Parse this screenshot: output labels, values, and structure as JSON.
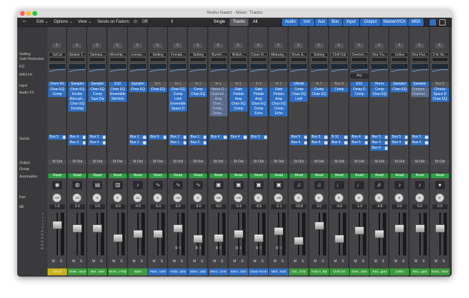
{
  "window": {
    "title": "Yeshu Naam - Mixer: Tracks"
  },
  "toolbar": {
    "edit_label": "Edit",
    "options_label": "Options",
    "view_label": "View",
    "sends_label": "Sends on Faders:",
    "sends_value": "Off",
    "view_tabs": [
      "Single",
      "Tracks",
      "All"
    ],
    "active_view_tab": "Tracks",
    "filter_tabs": [
      "Audio",
      "Inst",
      "Aux",
      "Bus",
      "Input",
      "Output",
      "Master/VCA",
      "MIDI"
    ]
  },
  "row_labels": {
    "setting": "Setting",
    "gain_reduction": "Gain Reduction",
    "eq": "EQ",
    "midi_fx": "MIDI FX",
    "input": "Input",
    "audio_fx": "Audio FX",
    "sends": "Sends",
    "output": "Output",
    "group": "Group",
    "automation": "Automation",
    "pan": "Pan",
    "db": "dB"
  },
  "strips": [
    {
      "setting": "SoCal",
      "input": "Drum Kit",
      "fx": [
        "Chan EQ",
        "Comp"
      ],
      "sends": [
        {
          "bus": "Bus 5"
        }
      ],
      "output": "St Out",
      "automation": "Read",
      "icon": "◉",
      "pan": "+27",
      "db": "1.0",
      "name": "SoCal",
      "name_color": "#c9b21a",
      "fader": 0.78,
      "solo": false,
      "ri": false
    },
    {
      "setting": "Shaker 1...",
      "input": "Sampler",
      "fx": [
        "Chan EQ",
        "Exciter",
        "Bitcrush...",
        "Chan EQ",
        "Envelop"
      ],
      "sends": [
        {
          "bus": "Bus 4"
        },
        {
          "bus": "Bus 3"
        }
      ],
      "output": "St Out",
      "automation": "Read",
      "icon": "◍",
      "pan": "-14",
      "db": "0.0",
      "name": "Shak...ance",
      "name_color": "#3d9b3d",
      "fader": 0.7,
      "solo": false,
      "ri": false
    },
    {
      "setting": "Steinwa...",
      "input": "Sampler",
      "fx": [
        "Chan EQ",
        "Comp",
        "Tape Dly"
      ],
      "sends": [
        {
          "bus": "Bus 3"
        },
        {
          "bus": "Bus 4"
        }
      ],
      "output": "St Out",
      "automation": "Read",
      "icon": "▤",
      "pan": "0",
      "db": "0.0",
      "name": "Stei...iano",
      "name_color": "#3d9b3d",
      "fader": 0.7,
      "solo": false,
      "ri": false
    },
    {
      "setting": "Worship...",
      "input": "ES2",
      "fx": [
        "Chan EQ",
        "Ensemble",
        "SilvVerb"
      ],
      "sends": [],
      "output": "St Out",
      "automation": "Read",
      "icon": "▥",
      "pan": "0",
      "db": "-8.0",
      "name": "Wors...t Pad",
      "name_color": "#3d9b3d",
      "fader": 0.45,
      "solo": false,
      "ri": false
    },
    {
      "setting": "Liverpo...",
      "input": "Sampler",
      "fx": [
        "Chan EQ"
      ],
      "sends": [
        {
          "bus": "Bus 2"
        },
        {
          "bus": "Bus 1"
        }
      ],
      "output": "St Out",
      "automation": "Read",
      "icon": "♪",
      "pan": "-14",
      "db": "-4.5",
      "name": "Bass",
      "name_color": "#3d9b3d",
      "fader": 0.56,
      "solo": false,
      "ri": false
    },
    {
      "setting": "Setting",
      "input": "In 1",
      "fx": [
        "Chan EQ"
      ],
      "sends": [
        {
          "bus": "Bus 6"
        }
      ],
      "output": "St Out",
      "automation": "Read",
      "icon": "∿",
      "pan": "0",
      "db": "-5.0",
      "name": "Parti...Verb",
      "name_color": "#2f6fc4",
      "fader": 0.55,
      "solo": false,
      "ri": false
    },
    {
      "setting": "Female...",
      "input": "In 1",
      "fx": [
        "Chan EQ",
        "Comp",
        "Limit",
        "Ensemble",
        "Space D"
      ],
      "sends": [
        {
          "bus": "Bus 2"
        },
        {
          "bus": "Bus 1"
        }
      ],
      "output": "St Out",
      "automation": "Read",
      "icon": "∿",
      "pan": "+24",
      "db": "0.0",
      "name": "Ambi...uitar",
      "name_color": "#2f6fc4",
      "fader": 0.7,
      "solo": false,
      "ri": true
    },
    {
      "setting": "Setting",
      "input": "In 1",
      "fx": [
        "Comp",
        "Chan EQ"
      ],
      "sends": [
        {
          "bus": "Bus 1"
        },
        {
          "bus": "Bus 2"
        }
      ],
      "output": "St Out",
      "automation": "Read",
      "icon": "∿",
      "pan": "0",
      "db": "-9.0",
      "name": "Elect...uitar",
      "name_color": "#2f6fc4",
      "fader": 0.42,
      "solo": false,
      "ri": true
    },
    {
      "setting": "Burnin'...",
      "input": "In 1",
      "fx": [
        "Noise G.",
        "Channel...",
        "Amp",
        "Chan...",
        "Comp...",
        "Delay..."
      ],
      "fx_dim": true,
      "sends": [
        {
          "bus": "Bus 4"
        }
      ],
      "output": "St Out",
      "automation": "Read",
      "icon": "▣",
      "pan": "+25",
      "db": "-8.0",
      "name": "Elect...Solo",
      "name_color": "#2f6fc4",
      "fader": 0.45,
      "solo": false,
      "ri": true
    },
    {
      "setting": "British...",
      "input": "In 1",
      "fx": [
        "Gate",
        "Pedals",
        "Amp",
        "Chan EQ",
        "Comp"
      ],
      "sends": [
        {
          "bus": "Bus 4"
        }
      ],
      "output": "St Out",
      "automation": "Read",
      "icon": "▣",
      "pan": "+25",
      "db": "-5.6",
      "name": "Elect...Dist",
      "name_color": "#2f6fc4",
      "fader": 0.55,
      "solo": false,
      "ri": true
    },
    {
      "setting": "Clean R...",
      "input": "In 1",
      "fx": [
        "Gate",
        "Pedals",
        "Amp",
        "Chan EQ",
        "Comp",
        "Echo"
      ],
      "sends": [
        {
          "bus": "Bus 5"
        }
      ],
      "output": "St Out",
      "automation": "Read",
      "icon": "▣",
      "pan": "0",
      "db": "-8.5",
      "name": "Clean Room",
      "name_color": "#2f6fc4",
      "fader": 0.44,
      "solo": false,
      "ri": true
    },
    {
      "setting": "Midrang...",
      "input": "In 1",
      "fx": [
        "Gate",
        "Pedals",
        "Amp",
        "Chan EQ",
        "Comp",
        "Echo"
      ],
      "sends": [],
      "output": "St Out",
      "automation": "Read",
      "icon": "▣",
      "pan": "+25",
      "db": "-2.1",
      "name": "Midr...Solo",
      "name_color": "#2f6fc4",
      "fader": 0.62,
      "solo": false,
      "ri": true
    },
    {
      "setting": "Drum &...",
      "input": "Ultrabt",
      "fx": [
        "Comp",
        "Chan EQ",
        "Limit"
      ],
      "sends": [
        {
          "bus": "Bus 5"
        },
        {
          "bus": "Bus 4"
        }
      ],
      "output": "St Out",
      "automation": "Read",
      "icon": "♫",
      "pan": "0",
      "db": "-10.8",
      "name": "Dru...lt 02",
      "name_color": "#3d9b3d",
      "fader": 0.38,
      "solo": false,
      "ri": false
    },
    {
      "setting": "Setting",
      "input": "In 1",
      "fx": [
        "Comp",
        "Chan EQ"
      ],
      "sends": [
        {
          "bus": "Bus 5"
        },
        {
          "bus": "Bus 4"
        }
      ],
      "output": "St Out",
      "automation": "Read",
      "icon": "♫",
      "pan": "0",
      "db": "3.0",
      "name": "TABLA_bip",
      "name_color": "#3d9b3d",
      "fader": 0.76,
      "solo": false,
      "ri": false
    },
    {
      "setting": "Chill Out",
      "input": "Bus 8",
      "fx": [
        "Comp"
      ],
      "sends": [
        {
          "bus": "B 10"
        },
        {
          "bus": "Bus 9"
        }
      ],
      "output": "St Out",
      "automation": "Read",
      "icon": "♩",
      "pan": "0",
      "db": "-9.0",
      "name": "Chill Out",
      "name_color": "#3d9b3d",
      "fader": 0.42,
      "solo": false,
      "ri": false
    },
    {
      "setting": "Overton...",
      "input": "ES1",
      "arp": "Arp",
      "fx": [
        "Delay D",
        "Comp"
      ],
      "sends": [
        {
          "bus": "Bus 4"
        },
        {
          "bus": "Bus 5"
        }
      ],
      "output": "St Out",
      "automation": "Read",
      "icon": "♩",
      "pan": "0",
      "db": "-1.0",
      "name": "Over...iano",
      "name_color": "#3d9b3d",
      "fader": 0.64,
      "solo": false,
      "ri": false
    },
    {
      "setting": "Xtra Tru...",
      "input": "Horns",
      "fx": [
        "Comp",
        "Chan EQ"
      ],
      "sends": [
        {
          "bus": "Bus 5"
        },
        {
          "bus": "Bus 4"
        },
        {
          "bus": "Bus 6"
        }
      ],
      "output": "St Out",
      "automation": "Read",
      "icon": "♬",
      "pan": "0",
      "db": "-4.6",
      "name": "Xtra...gato",
      "name_color": "#3d9b3d",
      "fader": 0.56,
      "solo": false,
      "ri": false
    },
    {
      "setting": "Cellos",
      "input": "Sampler",
      "fx": [
        "Chan EQ"
      ],
      "sends": [
        {
          "bus": "Bus 5"
        },
        {
          "bus": "Bus 4"
        }
      ],
      "output": "St Out",
      "automation": "Read",
      "icon": "♪",
      "pan": "0",
      "db": "0.0",
      "name": "Cellos",
      "name_color": "#3d9b3d",
      "fader": 0.7,
      "solo": false,
      "ri": false
    },
    {
      "setting": "Xtra Flut...",
      "input": "Sampler",
      "fx": [
        "Compre...",
        "Channel..."
      ],
      "fx_dim": true,
      "sends": [
        {
          "bus": "Bus 2"
        },
        {
          "bus": "Bus 4"
        }
      ],
      "output": "St Out",
      "automation": "Read",
      "icon": "♪",
      "pan": "0",
      "db": "0.0",
      "name": "Xtra...gato",
      "name_color": "#3d9b3d",
      "fader": 0.7,
      "solo": false,
      "ri": false
    },
    {
      "setting": "2.4s Sn...",
      "input": "Bus 5",
      "fx": [
        "Chorus",
        "Space D",
        "Chan EQ"
      ],
      "sends": [],
      "output": "St Out",
      "automation": "Read",
      "icon": "●",
      "pan": "0",
      "db": "0.0",
      "name": "Smal...mber",
      "name_color": "#3d9b3d",
      "fader": 0.7,
      "solo": false,
      "ri": false
    }
  ],
  "colors": {
    "accent": "#2f6fc4",
    "read_green": "#2d9e44",
    "background": "#3b3b3d"
  }
}
